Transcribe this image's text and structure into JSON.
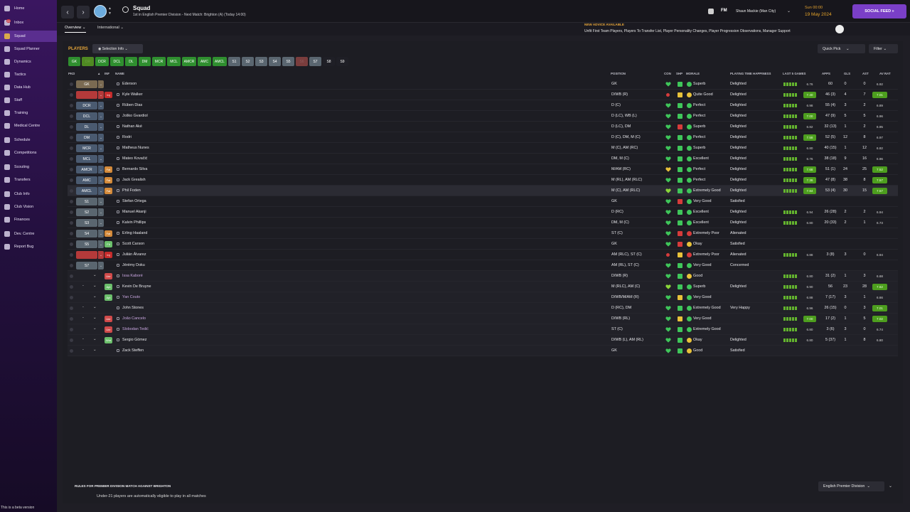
{
  "sidebar": {
    "items": [
      {
        "label": "Home",
        "icon": "home-icon"
      },
      {
        "label": "Inbox",
        "icon": "inbox-icon",
        "badge": "99"
      },
      {
        "label": "Squad",
        "icon": "squad-icon",
        "active": true
      },
      {
        "label": "Squad Planner",
        "icon": "squad-planner-icon"
      },
      {
        "label": "Dynamics",
        "icon": "dynamics-icon"
      },
      {
        "label": "Tactics",
        "icon": "tactics-icon"
      },
      {
        "label": "Data Hub",
        "icon": "data-hub-icon"
      },
      {
        "label": "Staff",
        "icon": "staff-icon"
      },
      {
        "label": "Training",
        "icon": "training-icon"
      },
      {
        "label": "Medical Centre",
        "icon": "medical-icon"
      },
      {
        "label": "Schedule",
        "icon": "schedule-icon"
      },
      {
        "label": "Competitions",
        "icon": "competitions-icon"
      },
      {
        "label": "Scouting",
        "icon": "scouting-icon"
      },
      {
        "label": "Transfers",
        "icon": "transfers-icon"
      },
      {
        "label": "Club Info",
        "icon": "club-info-icon"
      },
      {
        "label": "Club Vision",
        "icon": "club-vision-icon"
      },
      {
        "label": "Finances",
        "icon": "finances-icon"
      },
      {
        "label": "Dev. Centre",
        "icon": "dev-centre-icon"
      },
      {
        "label": "Report Bug",
        "icon": "report-bug-icon"
      }
    ],
    "beta_text": "This is a beta version"
  },
  "header": {
    "title": "Squad",
    "subtitle": "1st in English Premier Division - Next Match: Brighton (A) (Today 14:00)",
    "fm": "FM",
    "manager": "Shaun Mackie (Man City)",
    "time": "Sun 00:00",
    "date": "19 May 2024",
    "social_feed": "SOCIAL FEED"
  },
  "tabs": {
    "overview": "Overview",
    "international": "International"
  },
  "advice": {
    "title": "NEW ADVICE AVAILABLE",
    "text": "Unfit First Team Players, Players To Transfer List, Player Personality Changes, Player Progression Observations, Manager Support",
    "count": "6"
  },
  "toolbar": {
    "players_label": "PLAYERS",
    "selection_info": "Selection Info",
    "quick_pick": "Quick Pick",
    "filter": "Filter"
  },
  "position_chips": [
    "GK",
    "DR",
    "DCR",
    "DCL",
    "DL",
    "DM",
    "MCR",
    "MCL",
    "AMCR",
    "AMC",
    "AMCL",
    "S1",
    "S2",
    "S3",
    "S4",
    "S5",
    "S6",
    "S7",
    "S8",
    "S9"
  ],
  "columns": {
    "pkd": "PKD",
    "inf": "INF",
    "name": "NAME",
    "position": "POSITION",
    "con": "CON",
    "shp": "SHP",
    "morale": "MORALE",
    "pth": "PLAYING TIME HAPPINESS",
    "last5": "LAST 5 GAMES",
    "apps": "APPS",
    "gls": "GLS",
    "ast": "AST",
    "avrat": "AV RAT"
  },
  "players": [
    {
      "slot": "GK",
      "inf": "",
      "name": "Ederson",
      "pos": "GK",
      "con": "green",
      "shp": "green",
      "morale": "Superb",
      "mc": "green",
      "pth": "Delighted",
      "form": 5,
      "last": "6.76",
      "lg": false,
      "apps": "60",
      "gls": "0",
      "ast": "0",
      "av": "6.92",
      "ag": false
    },
    {
      "slot": "",
      "inf": "Inj",
      "name": "Kyle Walker",
      "pos": "D/WB (R)",
      "con": "red",
      "shp": "yellow",
      "morale": "Quite Good",
      "mc": "yellow",
      "pth": "Delighted",
      "form": 5,
      "last": "7.40",
      "lg": true,
      "apps": "46 (3)",
      "gls": "4",
      "ast": "7",
      "av": "7.01",
      "ag": true
    },
    {
      "slot": "DCR",
      "inf": "",
      "name": "Rúben Dias",
      "pos": "D (C)",
      "con": "green",
      "shp": "green",
      "morale": "Perfect",
      "mc": "green",
      "pth": "Delighted",
      "form": 5,
      "last": "6.98",
      "lg": false,
      "apps": "55 (4)",
      "gls": "3",
      "ast": "2",
      "av": "6.89",
      "ag": false
    },
    {
      "slot": "DCL",
      "inf": "",
      "name": "Joško Gvardiol",
      "pos": "D (LC), WB (L)",
      "con": "green",
      "shp": "green",
      "morale": "Perfect",
      "mc": "green",
      "pth": "Delighted",
      "form": 5,
      "last": "7.00",
      "lg": true,
      "apps": "47 (9)",
      "gls": "5",
      "ast": "5",
      "av": "6.96",
      "ag": false
    },
    {
      "slot": "DL",
      "inf": "",
      "name": "Nathan Aké",
      "pos": "D (LC), DM",
      "con": "green",
      "shp": "red",
      "morale": "Superb",
      "mc": "green",
      "pth": "Delighted",
      "form": 5,
      "last": "6.82",
      "lg": false,
      "apps": "32 (13)",
      "gls": "1",
      "ast": "2",
      "av": "6.95",
      "ag": false
    },
    {
      "slot": "DM",
      "inf": "",
      "name": "Rodri",
      "pos": "D (C), DM, M (C)",
      "con": "green",
      "shp": "green",
      "morale": "Perfect",
      "mc": "green",
      "pth": "Delighted",
      "form": 5,
      "last": "7.58",
      "lg": true,
      "apps": "52 (5)",
      "gls": "12",
      "ast": "8",
      "av": "6.97",
      "ag": false
    },
    {
      "slot": "MCR",
      "inf": "",
      "name": "Matheus Nunes",
      "pos": "M (C), AM (RC)",
      "con": "green",
      "shp": "green",
      "morale": "Superb",
      "mc": "green",
      "pth": "Delighted",
      "form": 5,
      "last": "6.80",
      "lg": false,
      "apps": "40 (15)",
      "gls": "1",
      "ast": "12",
      "av": "6.82",
      "ag": false
    },
    {
      "slot": "MCL",
      "inf": "",
      "name": "Mateo Kovačić",
      "pos": "DM, M (C)",
      "con": "green",
      "shp": "green",
      "morale": "Excellent",
      "mc": "green",
      "pth": "Delighted",
      "form": 5,
      "last": "6.76",
      "lg": false,
      "apps": "38 (18)",
      "gls": "9",
      "ast": "16",
      "av": "6.96",
      "ag": false
    },
    {
      "slot": "AMCR",
      "inf": "Fat",
      "name": "Bernardo Silva",
      "pos": "M/AM (RC)",
      "con": "yellow",
      "shp": "green",
      "morale": "Perfect",
      "mc": "green",
      "pth": "Delighted",
      "form": 5,
      "last": "7.68",
      "lg": true,
      "apps": "51 (1)",
      "gls": "24",
      "ast": "25",
      "av": "7.52",
      "ag": true
    },
    {
      "slot": "AMC",
      "inf": "Fat",
      "name": "Jack Grealish",
      "pos": "M (RL), AM (RLC)",
      "con": "green",
      "shp": "green",
      "morale": "Perfect",
      "mc": "green",
      "pth": "Delighted",
      "form": 5,
      "last": "7.36",
      "lg": true,
      "apps": "47 (8)",
      "gls": "38",
      "ast": "8",
      "av": "7.57",
      "ag": true
    },
    {
      "slot": "AMCL",
      "inf": "Fat",
      "name": "Phil Foden",
      "pos": "M (C), AM (RLC)",
      "con": "lime",
      "shp": "green",
      "morale": "Extremely Good",
      "mc": "green",
      "pth": "Delighted",
      "form": 5,
      "last": "7.84",
      "lg": true,
      "apps": "53 (4)",
      "gls": "30",
      "ast": "15",
      "av": "7.57",
      "ag": true,
      "hl": true
    },
    {
      "slot": "S1",
      "inf": "",
      "name": "Stefan Ortega",
      "pos": "GK",
      "con": "green",
      "shp": "red",
      "morale": "Very Good",
      "mc": "green",
      "pth": "Satisfied",
      "form": 0,
      "last": "",
      "lg": false,
      "apps": "",
      "gls": "",
      "ast": "",
      "av": "",
      "ag": false
    },
    {
      "slot": "S2",
      "inf": "",
      "name": "Manuel Akanji",
      "pos": "D (RC)",
      "con": "green",
      "shp": "green",
      "morale": "Excellent",
      "mc": "green",
      "pth": "Delighted",
      "form": 5,
      "last": "6.94",
      "lg": false,
      "apps": "26 (28)",
      "gls": "2",
      "ast": "2",
      "av": "6.94",
      "ag": false
    },
    {
      "slot": "S3",
      "inf": "",
      "name": "Kalvin Phillips",
      "pos": "DM, M (C)",
      "con": "green",
      "shp": "green",
      "morale": "Excellent",
      "mc": "green",
      "pth": "Delighted",
      "form": 5,
      "last": "6.80",
      "lg": false,
      "apps": "20 (33)",
      "gls": "2",
      "ast": "1",
      "av": "6.73",
      "ag": false
    },
    {
      "slot": "S4",
      "inf": "Fat",
      "name": "Erling Haaland",
      "pos": "ST (C)",
      "con": "green",
      "shp": "red",
      "morale": "Extremely Poor",
      "mc": "red",
      "pth": "Alienated",
      "form": 0,
      "last": "",
      "lg": false,
      "apps": "",
      "gls": "",
      "ast": "",
      "av": "",
      "ag": false
    },
    {
      "slot": "S5",
      "inf": "Fit",
      "name": "Scott Carson",
      "pos": "GK",
      "con": "green",
      "shp": "red",
      "morale": "Okay",
      "mc": "yellow",
      "pth": "Satisfied",
      "form": 0,
      "last": "",
      "lg": false,
      "apps": "",
      "gls": "",
      "ast": "",
      "av": "",
      "ag": false
    },
    {
      "slot": "",
      "inf": "Inj",
      "name": "Julián Álvarez",
      "pos": "AM (RLC), ST (C)",
      "con": "red",
      "shp": "yellow",
      "morale": "Extremely Poor",
      "mc": "red",
      "pth": "Alienated",
      "form": 5,
      "last": "6.88",
      "lg": false,
      "apps": "3 (8)",
      "gls": "3",
      "ast": "0",
      "av": "6.94",
      "ag": false
    },
    {
      "slot": "S7",
      "inf": "",
      "name": "Jérémy Doku",
      "pos": "AM (RL), ST (C)",
      "con": "green",
      "shp": "green",
      "morale": "Very Good",
      "mc": "green",
      "pth": "Concerned",
      "form": 0,
      "last": "",
      "lg": false,
      "apps": "",
      "gls": "",
      "ast": "",
      "av": "",
      "ag": false
    },
    {
      "slot": "",
      "inf": "Unr",
      "name": "Issa Kaboré",
      "pos": "D/WB (R)",
      "con": "green",
      "shp": "green",
      "morale": "Good",
      "mc": "yellow",
      "pth": "",
      "form": 5,
      "last": "6.80",
      "lg": false,
      "apps": "31 (2)",
      "gls": "1",
      "ast": "3",
      "av": "6.68",
      "ag": false,
      "dim": true
    },
    {
      "slot": "-",
      "inf": "Apt",
      "name": "Kevin De Bruyne",
      "pos": "M (RLC), AM (C)",
      "con": "lime",
      "shp": "green",
      "morale": "Superb",
      "mc": "green",
      "pth": "Delighted",
      "form": 5,
      "last": "6.90",
      "lg": false,
      "apps": "56",
      "gls": "23",
      "ast": "28",
      "av": "7.62",
      "ag": true
    },
    {
      "slot": "",
      "inf": "Apt",
      "name": "Yan Couto",
      "pos": "D/WB/M/AM (R)",
      "con": "green",
      "shp": "yellow",
      "morale": "Very Good",
      "mc": "green",
      "pth": "",
      "form": 5,
      "last": "6.88",
      "lg": false,
      "apps": "7 (17)",
      "gls": "3",
      "ast": "1",
      "av": "6.66",
      "ag": false,
      "dim": true
    },
    {
      "slot": "-",
      "inf": "",
      "name": "John Stones",
      "pos": "D (RC), DM",
      "con": "green",
      "shp": "green",
      "morale": "Extremely Good",
      "mc": "green",
      "pth": "Very Happy",
      "form": 5,
      "last": "6.96",
      "lg": false,
      "apps": "26 (15)",
      "gls": "0",
      "ast": "3",
      "av": "7.01",
      "ag": true
    },
    {
      "slot": "-",
      "inf": "Unr",
      "name": "João Cancelo",
      "pos": "D/WB (RL)",
      "con": "green",
      "shp": "yellow",
      "morale": "Very Good",
      "mc": "green",
      "pth": "",
      "form": 5,
      "last": "7.00",
      "lg": true,
      "apps": "17 (2)",
      "gls": "1",
      "ast": "5",
      "av": "7.02",
      "ag": true,
      "dim": true
    },
    {
      "slot": "",
      "inf": "Unr",
      "name": "Slobodan Tedić",
      "pos": "ST (C)",
      "con": "green",
      "shp": "green",
      "morale": "Extremely Good",
      "mc": "green",
      "pth": "",
      "form": 5,
      "last": "6.80",
      "lg": false,
      "apps": "3 (6)",
      "gls": "3",
      "ast": "0",
      "av": "6.74",
      "ag": false,
      "dim": true
    },
    {
      "slot": "-",
      "inf": "Wnt",
      "name": "Sergio Gómez",
      "pos": "D/WB (L), AM (RL)",
      "con": "green",
      "shp": "green",
      "morale": "Okay",
      "mc": "yellow",
      "pth": "Delighted",
      "form": 5,
      "last": "6.80",
      "lg": false,
      "apps": "5 (37)",
      "gls": "1",
      "ast": "8",
      "av": "6.80",
      "ag": false
    },
    {
      "slot": "-",
      "inf": "",
      "name": "Zack Steffen",
      "pos": "GK",
      "con": "green",
      "shp": "green",
      "morale": "Good",
      "mc": "yellow",
      "pth": "Satisfied",
      "form": 0,
      "last": "",
      "lg": false,
      "apps": "",
      "gls": "",
      "ast": "",
      "av": "",
      "ag": false
    }
  ],
  "footer": {
    "rules_title": "RULES FOR PREMIER DIVISION MATCH AGAINST BRIGHTON",
    "rules_text": "Under-21 players are automatically eligible to play in all matches",
    "league": "English Premier Division"
  },
  "colors": {
    "accent": "#7a3fc7",
    "orange": "#e8a73a",
    "green": "#4d9e1e",
    "red": "#d63b3b"
  }
}
